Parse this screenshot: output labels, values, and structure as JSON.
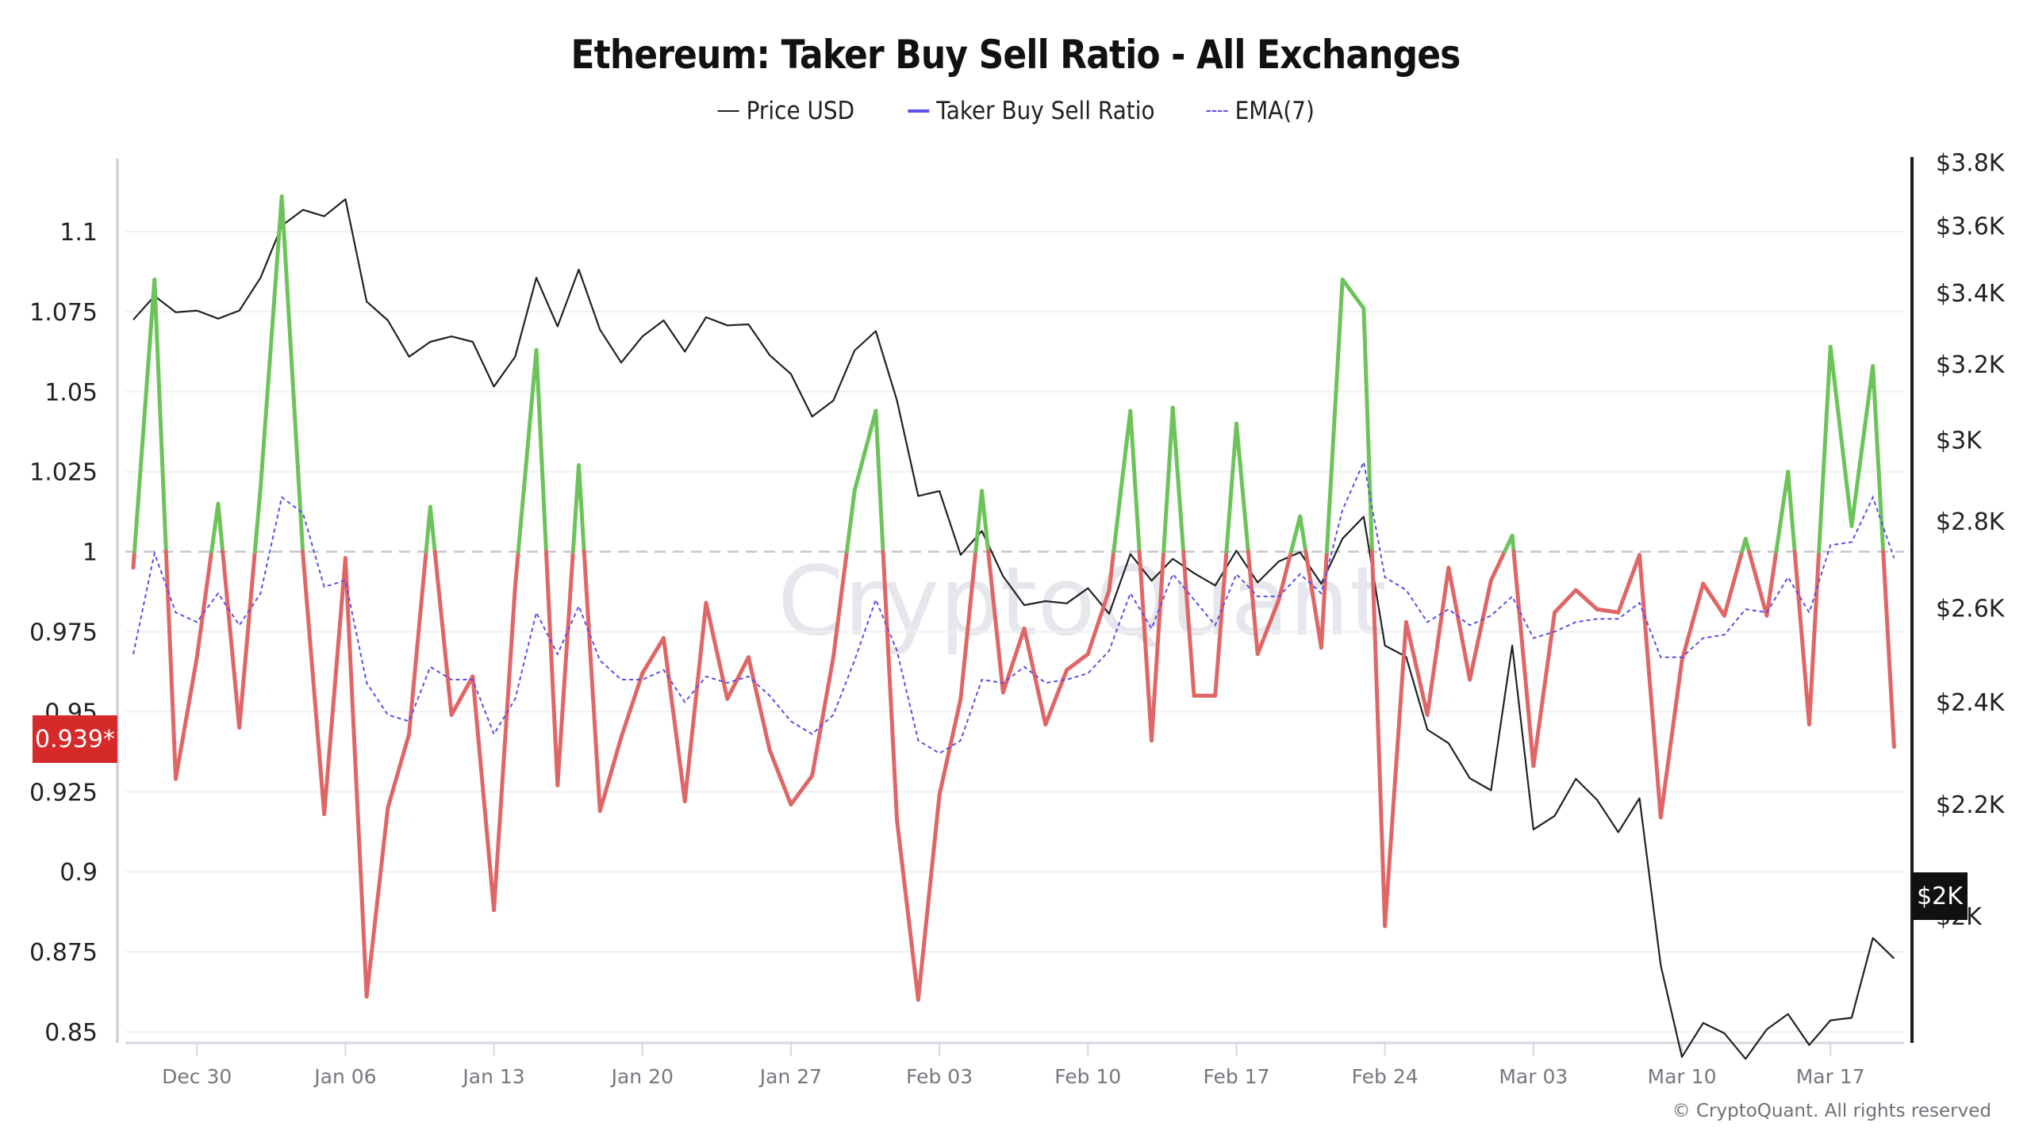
{
  "chart_data": {
    "type": "line",
    "title": "Ethereum: Taker Buy Sell Ratio - All Exchanges",
    "legend": [
      {
        "name": "Price USD",
        "style": "solid-thin",
        "color": "#222222"
      },
      {
        "name": "Taker Buy Sell Ratio",
        "style": "solid-thick",
        "color": "#5b4de8"
      },
      {
        "name": "EMA(7)",
        "style": "dashed",
        "color": "#5b4de8"
      }
    ],
    "legend_position": "top-center",
    "x": [
      "Dec 27",
      "Dec 28",
      "Dec 29",
      "Dec 30",
      "Dec 31",
      "Jan 01",
      "Jan 02",
      "Jan 03",
      "Jan 04",
      "Jan 05",
      "Jan 06",
      "Jan 07",
      "Jan 08",
      "Jan 09",
      "Jan 10",
      "Jan 11",
      "Jan 12",
      "Jan 13",
      "Jan 14",
      "Jan 15",
      "Jan 16",
      "Jan 17",
      "Jan 18",
      "Jan 19",
      "Jan 20",
      "Jan 21",
      "Jan 22",
      "Jan 23",
      "Jan 24",
      "Jan 25",
      "Jan 26",
      "Jan 27",
      "Jan 28",
      "Jan 29",
      "Jan 30",
      "Jan 31",
      "Feb 01",
      "Feb 02",
      "Feb 03",
      "Feb 04",
      "Feb 05",
      "Feb 06",
      "Feb 07",
      "Feb 08",
      "Feb 09",
      "Feb 10",
      "Feb 11",
      "Feb 12",
      "Feb 13",
      "Feb 14",
      "Feb 15",
      "Feb 16",
      "Feb 17",
      "Feb 18",
      "Feb 19",
      "Feb 20",
      "Feb 21",
      "Feb 22",
      "Feb 23",
      "Feb 24",
      "Feb 25",
      "Feb 26",
      "Feb 27",
      "Feb 28",
      "Mar 01",
      "Mar 02",
      "Mar 03",
      "Mar 04",
      "Mar 05",
      "Mar 06",
      "Mar 07",
      "Mar 08",
      "Mar 09",
      "Mar 10",
      "Mar 11",
      "Mar 12",
      "Mar 13",
      "Mar 14",
      "Mar 15",
      "Mar 16",
      "Mar 17",
      "Mar 18",
      "Mar 19",
      "Mar 20"
    ],
    "series": [
      {
        "name": "Taker Buy Sell Ratio",
        "axis": "left",
        "color_above_1": "#6cc35a",
        "color_below_1": "#e06666",
        "values": [
          0.995,
          1.085,
          0.929,
          0.967,
          1.015,
          0.945,
          1.02,
          1.111,
          0.999,
          0.918,
          0.998,
          0.861,
          0.92,
          0.943,
          1.014,
          0.949,
          0.961,
          0.888,
          0.989,
          1.063,
          0.927,
          1.027,
          0.919,
          0.942,
          0.962,
          0.973,
          0.922,
          0.984,
          0.954,
          0.967,
          0.938,
          0.921,
          0.93,
          0.967,
          1.019,
          1.044,
          0.916,
          0.86,
          0.924,
          0.954,
          1.019,
          0.956,
          0.976,
          0.946,
          0.963,
          0.968,
          0.988,
          1.044,
          0.941,
          1.045,
          0.955,
          0.955,
          1.04,
          0.968,
          0.985,
          1.011,
          0.97,
          1.085,
          1.076,
          0.883,
          0.978,
          0.949,
          0.995,
          0.96,
          0.991,
          1.005,
          0.933,
          0.981,
          0.988,
          0.982,
          0.981,
          0.999,
          0.917,
          0.966,
          0.99,
          0.98,
          1.004,
          0.98,
          1.025,
          0.946,
          1.064,
          1.008,
          1.058,
          0.939
        ]
      },
      {
        "name": "EMA(7)",
        "axis": "left",
        "color": "#5b4de8",
        "values": [
          0.968,
          0.9995,
          0.981,
          0.978,
          0.987,
          0.977,
          0.987,
          1.017,
          1.012,
          0.989,
          0.991,
          0.959,
          0.949,
          0.947,
          0.964,
          0.96,
          0.96,
          0.943,
          0.954,
          0.981,
          0.968,
          0.983,
          0.966,
          0.96,
          0.96,
          0.963,
          0.953,
          0.961,
          0.959,
          0.961,
          0.955,
          0.947,
          0.943,
          0.949,
          0.966,
          0.985,
          0.969,
          0.941,
          0.937,
          0.941,
          0.96,
          0.959,
          0.964,
          0.959,
          0.96,
          0.962,
          0.969,
          0.987,
          0.976,
          0.993,
          0.985,
          0.977,
          0.993,
          0.986,
          0.986,
          0.993,
          0.987,
          1.013,
          1.028,
          0.992,
          0.988,
          0.978,
          0.982,
          0.977,
          0.98,
          0.986,
          0.973,
          0.975,
          0.978,
          0.979,
          0.979,
          0.984,
          0.967,
          0.967,
          0.973,
          0.974,
          0.982,
          0.981,
          0.992,
          0.981,
          1.002,
          1.003,
          1.017,
          0.998
        ]
      },
      {
        "name": "Price USD",
        "axis": "right",
        "color": "#222222",
        "values": [
          3323,
          3391,
          3344,
          3349,
          3326,
          3349,
          3444,
          3600,
          3649,
          3629,
          3682,
          3375,
          3321,
          3220,
          3261,
          3276,
          3261,
          3139,
          3220,
          3444,
          3304,
          3468,
          3295,
          3204,
          3276,
          3321,
          3234,
          3330,
          3307,
          3310,
          3224,
          3173,
          3060,
          3102,
          3237,
          3291,
          3102,
          2860,
          2872,
          2720,
          2776,
          2671,
          2606,
          2615,
          2610,
          2644,
          2587,
          2722,
          2661,
          2711,
          2678,
          2650,
          2730,
          2657,
          2705,
          2726,
          2654,
          2758,
          2810,
          2518,
          2494,
          2344,
          2317,
          2249,
          2226,
          2518,
          2153,
          2178,
          2248,
          2208,
          2148,
          2211,
          1918,
          1774,
          1826,
          1810,
          1771,
          1816,
          1840,
          1792,
          1830,
          1834,
          1963,
          1929
        ]
      }
    ],
    "left_axis": {
      "ticks": [
        1.1,
        1.075,
        1.05,
        1.025,
        1,
        0.975,
        0.95,
        0.925,
        0.9,
        0.875,
        0.85
      ],
      "tick_labels": [
        "1.1",
        "1.075",
        "1.05",
        "1.025",
        "1",
        "0.975",
        "0.95",
        "0.925",
        "0.9",
        "0.875",
        "0.85"
      ],
      "range": [
        0.8465,
        1.1228
      ],
      "reference_line": 1
    },
    "right_axis": {
      "scale": "log",
      "ticks": [
        3800,
        3600,
        3400,
        3200,
        3000,
        2800,
        2600,
        2400,
        2200,
        2000
      ],
      "tick_labels": [
        "$3.8K",
        "$3.6K",
        "$3.4K",
        "$3.2K",
        "$3K",
        "$2.8K",
        "$2.6K",
        "$2.4K",
        "$2.2K",
        "$2K"
      ]
    },
    "x_ticks": [
      "Dec 30",
      "Jan 06",
      "Jan 13",
      "Jan 20",
      "Jan 27",
      "Feb 03",
      "Feb 10",
      "Feb 17",
      "Feb 24",
      "Mar 03",
      "Mar 10",
      "Mar 17"
    ],
    "grid": true,
    "last_value_labels": {
      "ratio": "0.939*",
      "price": "$2K"
    }
  },
  "watermark": "CryptoQuant",
  "footer": "© CryptoQuant. All rights reserved"
}
